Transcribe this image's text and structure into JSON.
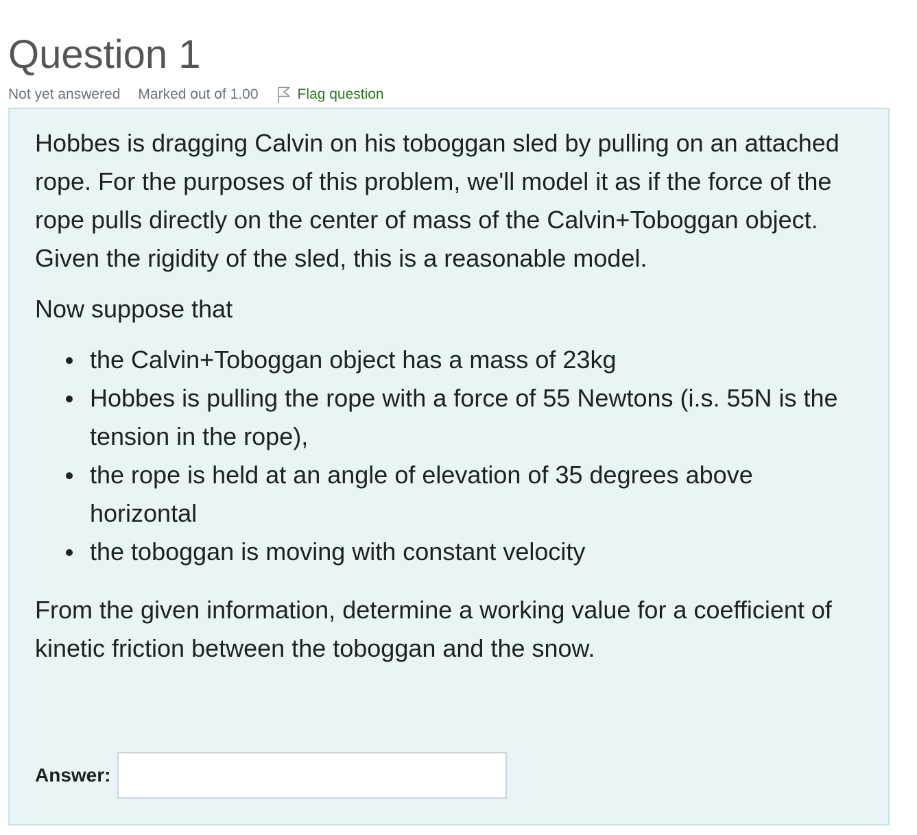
{
  "question": {
    "title": "Question 1",
    "state": "Not yet answered",
    "grade": "Marked out of 1.00",
    "flag_label": "Flag question",
    "flag_icon": "flag-outline-icon",
    "colors": {
      "title": "#555555",
      "info": "#6a737b",
      "flag": "#2a7a1f",
      "content_bg": "#e8f4f6",
      "content_border": "#c7e3e8"
    }
  },
  "question_text": {
    "intro": "Hobbes is dragging Calvin on his toboggan sled by pulling on an attached rope.  For the purposes of this problem, we'll model it as if the force of the rope pulls directly on the center of mass of the Calvin+Toboggan object.  Given the rigidity of the sled, this is a reasonable model.",
    "lead": "Now suppose that",
    "bullets": [
      "the Calvin+Toboggan object has a mass of 23kg",
      "Hobbes is pulling the rope with a force of 55 Newtons (i.s. 55N is the tension in the rope),",
      "the rope is held at an angle of elevation of 35 degrees above horizontal",
      "the toboggan is moving with constant velocity"
    ],
    "task": "From the given information, determine a working value for a coefficient of kinetic friction between the toboggan and the snow."
  },
  "answer": {
    "label": "Answer:",
    "value": "",
    "placeholder": ""
  }
}
